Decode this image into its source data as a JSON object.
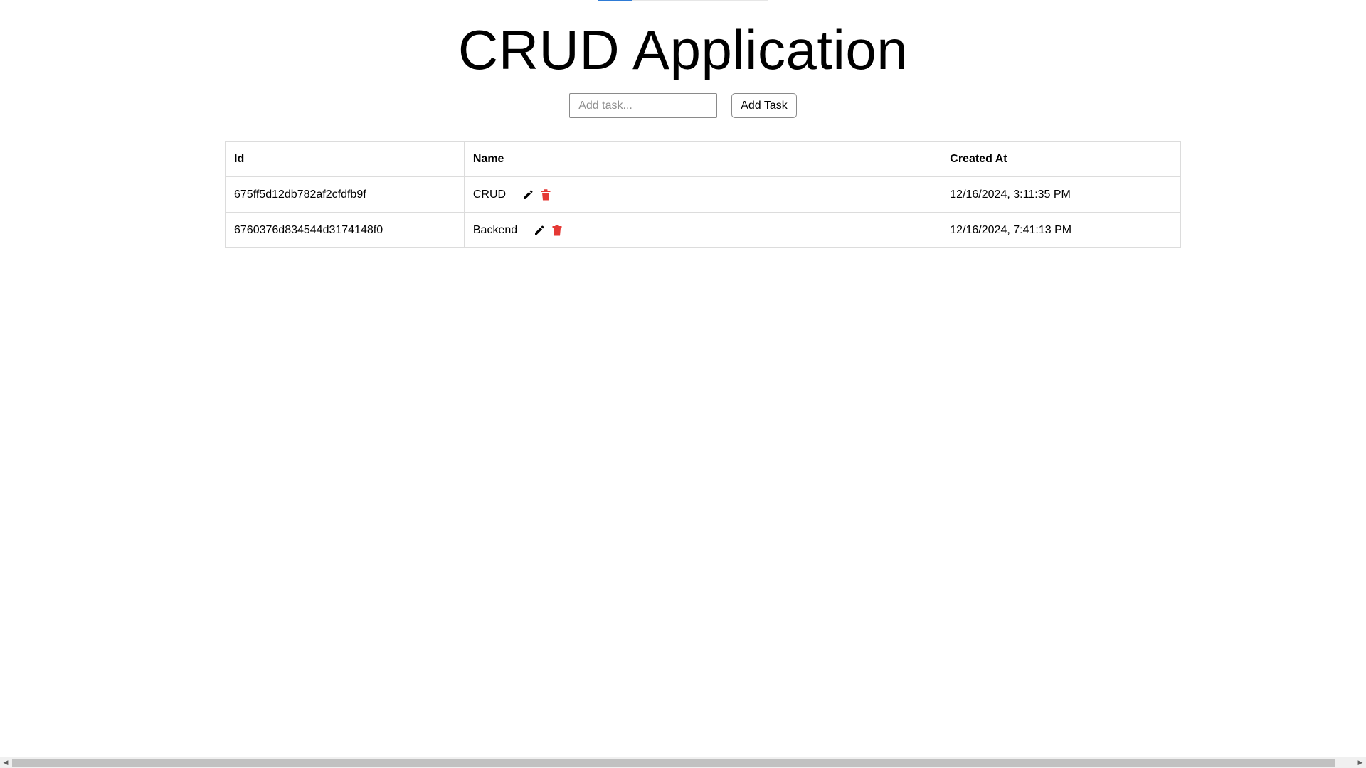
{
  "loading_bar": {
    "progress": 0.2
  },
  "page": {
    "title": "CRUD Application"
  },
  "form": {
    "input_value": "",
    "input_placeholder": "Add task...",
    "add_button_label": "Add Task"
  },
  "table": {
    "headers": {
      "id": "Id",
      "name": "Name",
      "created_at": "Created At"
    },
    "rows": [
      {
        "id": "675ff5d12db782af2cfdfb9f",
        "name": "CRUD",
        "created_at": "12/16/2024, 3:11:35 PM"
      },
      {
        "id": "6760376d834544d3174148f0",
        "name": "Backend",
        "created_at": "12/16/2024, 7:41:13 PM"
      }
    ]
  },
  "icons": {
    "edit": "pencil-icon",
    "delete": "trash-icon"
  },
  "colors": {
    "delete_icon": "#e53935",
    "edit_icon": "#000000",
    "loading_bar": "#2e7bd6"
  }
}
